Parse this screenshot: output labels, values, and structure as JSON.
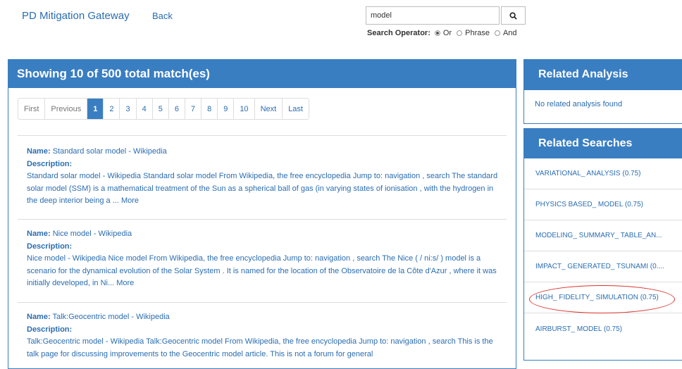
{
  "header": {
    "brand": "PD Mitigation Gateway",
    "back_label": "Back"
  },
  "search": {
    "value": "model",
    "button_icon": "search-icon",
    "operator_label": "Search Operator:",
    "operators": [
      "Or",
      "Phrase",
      "And"
    ],
    "selected_operator": "Or"
  },
  "results": {
    "heading": "Showing 10 of 500 total match(es)",
    "pager": [
      "First",
      "Previous",
      "1",
      "2",
      "3",
      "4",
      "5",
      "6",
      "7",
      "8",
      "9",
      "10",
      "Next",
      "Last"
    ],
    "active_page": "1",
    "name_label": "Name:",
    "description_label": "Description:",
    "more_label": "More",
    "items": [
      {
        "name": "Standard solar model - Wikipedia",
        "description": "Standard solar model - Wikipedia Standard solar model From Wikipedia, the free encyclopedia Jump to: navigation , search The standard solar model (SSM) is a mathematical treatment of the Sun as a spherical ball of gas (in varying states of ionisation , with the hydrogen in the deep interior being a ..."
      },
      {
        "name": "Nice model - Wikipedia",
        "description": "Nice model - Wikipedia Nice model From Wikipedia, the free encyclopedia Jump to: navigation , search The Nice ( / ni:s/ ) model is a scenario for the dynamical evolution of the Solar System . It is named for the location of the Observatoire de la Côte d'Azur , where it was initially developed, in Ni..."
      },
      {
        "name": "Talk:Geocentric model - Wikipedia",
        "description": "Talk:Geocentric model - Wikipedia Talk:Geocentric model From Wikipedia, the free encyclopedia Jump to: navigation , search This is the talk page for discussing improvements to the Geocentric model article. This is not a forum for general"
      }
    ]
  },
  "related_analysis": {
    "title": "Related Analysis",
    "empty_text": "No related analysis found"
  },
  "related_searches": {
    "title": "Related Searches",
    "items": [
      "VARIATIONAL_ ANALYSIS (0.75)",
      "PHYSICS BASED_ MODEL (0.75)",
      "MODELING_ SUMMARY_ TABLE_AN...",
      "IMPACT_ GENERATED_ TSUNAMI (0....",
      "HIGH_ FIDELITY_ SIMULATION (0.75)",
      "AIRBURST_ MODEL (0.75)"
    ],
    "highlighted_item": "HIGH_ FIDELITY_ SIMULATION (0.75)",
    "highlight_color": "#d9342b"
  },
  "colors": {
    "accent": "#3a7ec2",
    "link": "#2a6db0"
  }
}
